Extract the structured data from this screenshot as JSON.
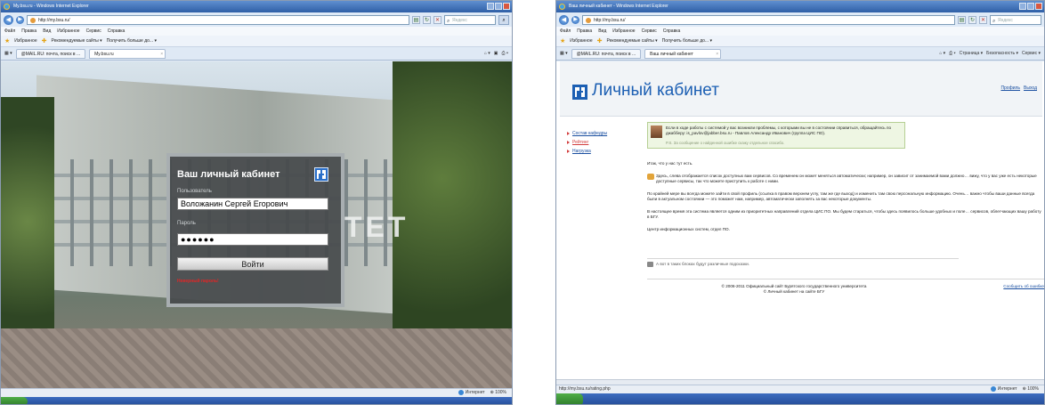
{
  "left": {
    "window_title": "My.bsu.ru - Windows Internet Explorer",
    "address": "http://my.bsu.ru/",
    "search_placeholder": "Яндекс",
    "menu": [
      "Файл",
      "Правка",
      "Вид",
      "Избранное",
      "Сервис",
      "Справка"
    ],
    "favorites": {
      "label": "Избранное",
      "items": [
        "Рекомендуемые сайты ▾",
        "Получить больше до... ▾"
      ]
    },
    "tabs": [
      "@MAIL.RU: почта, поиск в ...",
      "My.bsu.ru"
    ],
    "background_text": "ТЕТ",
    "login": {
      "title": "Ваш личный кабинет",
      "user_label": "Пользователь",
      "user_value": "Воложанин Сергей Егорович",
      "password_label": "Пароль",
      "password_value": "●●●●●●",
      "submit": "Войти",
      "error": "Неверный пароль!"
    },
    "status": {
      "zone": "Интернет",
      "zoom": "100%"
    }
  },
  "right": {
    "window_title": "Ваш личный кабинет - Windows Internet Explorer",
    "address": "http://my.bsu.ru/",
    "search_placeholder": "Яндекс",
    "menu": [
      "Файл",
      "Правка",
      "Вид",
      "Избранное",
      "Сервис",
      "Справка"
    ],
    "favorites": {
      "label": "Избранное",
      "items": [
        "Рекомендуемые сайты ▾",
        "Получить больше до... ▾"
      ]
    },
    "tabs": [
      "@MAIL.RU: почта, поиск в ...",
      "Ваш личный кабинет"
    ],
    "command_bar": [
      "Страница ▾",
      "Безопасность ▾",
      "Сервис ▾"
    ],
    "header": {
      "title": "Личный кабинет",
      "links": [
        "Профиль",
        "Выход"
      ]
    },
    "sidebar": [
      "Состав кафедры",
      "Рейтинг",
      "Нагрузка"
    ],
    "notice": {
      "text": "Если в ходе работы с системой у вас возникли проблемы, с которыми вы не в состоянии справиться, обращайтесь по джабберу: is_pavlov@jabber.bsu.ru - Павлов Александр Иванович (группа ЦИС ПО).",
      "ps": "P.S. За сообщение о найденной ошибке скажу отдельное спасибо."
    },
    "body": [
      "Итак, что у нас тут есть.",
      "Здесь, слева отображается список доступных вам сервисов. Со временем он может меняться автоматически; например, он зависит от занимаемой вами должно… вижу, что у вас уже есть некоторые доступные сервисы, так что можете приступить к работе с ними.",
      "По крайней мере вы всегда можете зайти в свой профиль (ссылка в правом верхнем углу, там же где выход) и изменить там свою персональную информацию. Очень… важно чтобы ваши данные всегда были в актуальном состоянии — это поможет нам, например, автоматически заполнять за вас некоторые документы.",
      "В настоящее время эта система является одним из приоритетных направлений отдела ЦИС ПО. Мы будем стараться, чтобы здесь появилось больше удобных и поле… сервисов, облегчающих вашу работу в БГУ.",
      "Центр информационных систем, отдел ПО."
    ],
    "hint": "А вот в таких блоках будут различные подсказки.",
    "footer": {
      "copy1": "© 2006-2011 Официальный сайт Бурятского государственного университета",
      "copy2": "© Личный кабинет на сайте БГУ",
      "report": "Сообщить об ошибке"
    },
    "status": {
      "url": "http://my.bsu.ru/rating.php",
      "zone": "Интернет",
      "zoom": "100%"
    }
  }
}
